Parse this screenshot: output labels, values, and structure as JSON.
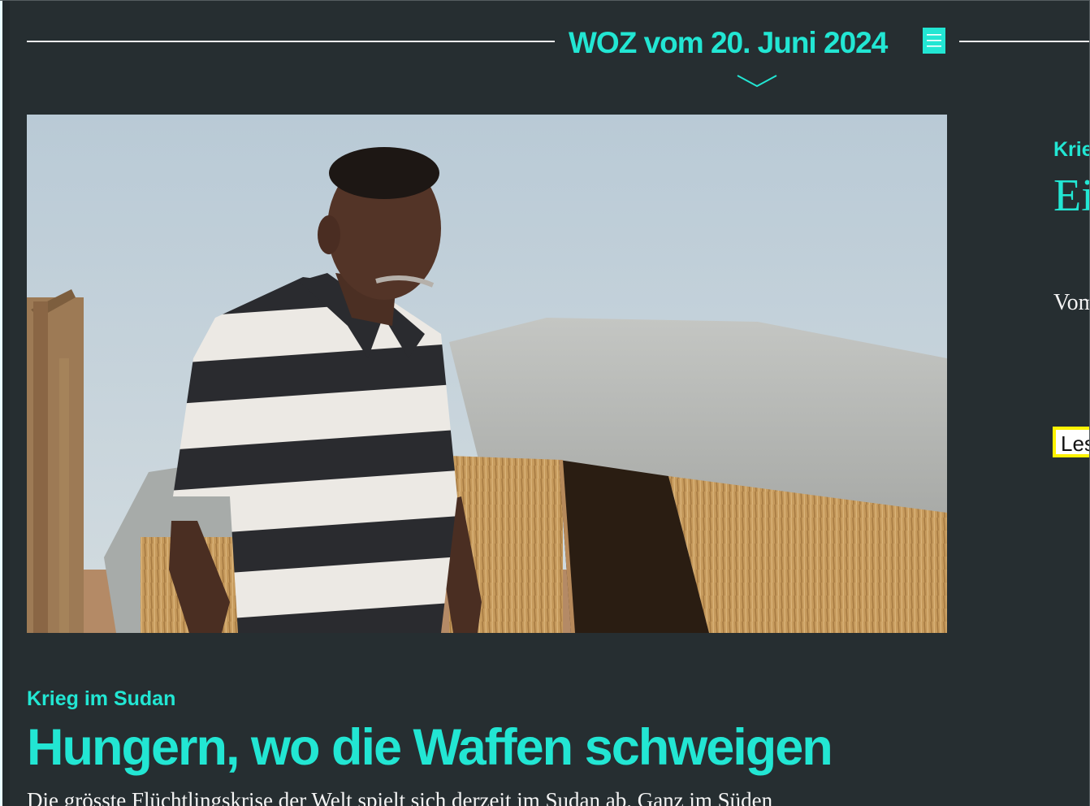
{
  "header": {
    "issue_title": "WOZ vom 20. Juni 2024",
    "menu_icon": "hamburger-menu-icon",
    "expand_icon": "chevron-down-icon"
  },
  "main_article": {
    "image_alt": "Ein Mann in gestreiftem Poloshirt steht vor einer Strohhütte mit Plane in einem Flüchtlingslager",
    "kicker": "Krieg im Sudan",
    "headline": "Hungern, wo die Waffen schweigen",
    "lead": "Die grösste Flüchtlingskrise der Welt spielt sich derzeit im Sudan ab. Ganz im Süden"
  },
  "side_article": {
    "kicker": "Krieg",
    "headline": "Ein Frieden",
    "lead": "Vom Kapital Frieden Bürgern",
    "button_label": "Lesen"
  },
  "colors": {
    "background": "#262e31",
    "accent": "#22e6d3",
    "focus_outline": "#fff200"
  }
}
